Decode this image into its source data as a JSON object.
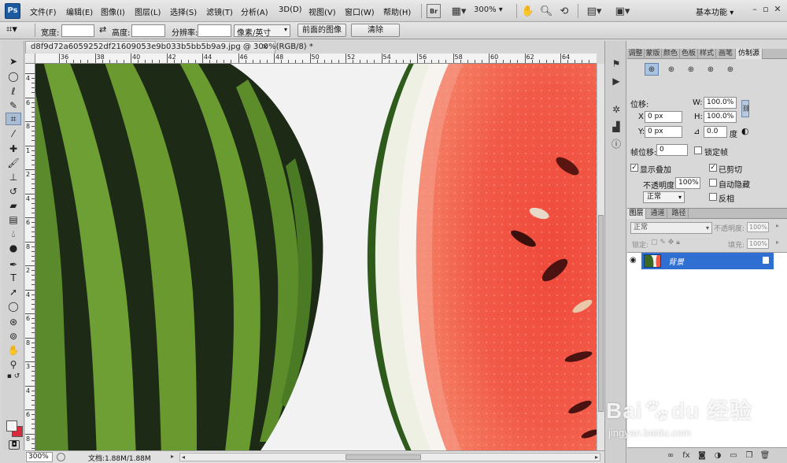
{
  "app": {
    "logo_text": "Ps",
    "menus": [
      "文件(F)",
      "编辑(E)",
      "图像(I)",
      "图层(L)",
      "选择(S)",
      "滤镜(T)",
      "分析(A)",
      "3D(D)",
      "视图(V)",
      "窗口(W)",
      "帮助(H)"
    ],
    "bridge_label": "Br",
    "zoom_level": "300%",
    "workspace": "基本功能",
    "workspace_arrow": "▾"
  },
  "options_bar": {
    "width_label": "宽度:",
    "width_value": "",
    "swap_icon": "⇄",
    "height_label": "高度:",
    "height_value": "",
    "resolution_label": "分辨率:",
    "resolution_value": "",
    "unit_select": "像素/英寸",
    "front_image_button": "前面的图像",
    "clear_button": "清除"
  },
  "document": {
    "tab_title": "d8f9d72a6059252df21609053e9b033b5bb5b9a9.jpg @ 300%(RGB/8) *",
    "close_symbol": "×",
    "ruler_h_labels": [
      "36",
      "38",
      "40",
      "42",
      "44",
      "46",
      "48",
      "50",
      "52",
      "54",
      "56",
      "58",
      "60",
      "62",
      "64"
    ],
    "ruler_v_labels": [
      "4",
      "6",
      "8",
      "1",
      "2",
      "4",
      "6",
      "8",
      "2",
      "4",
      "6",
      "8",
      "3",
      "4",
      "6",
      "8"
    ]
  },
  "status_bar": {
    "zoom": "300%",
    "doc_info": "文档:1.88M/1.88M"
  },
  "clone_source_panel": {
    "tabs": [
      "调整",
      "蒙版",
      "颜色",
      "色板",
      "样式",
      "画笔",
      "仿制源"
    ],
    "active_tab": "仿制源",
    "offset_label": "位移:",
    "x_label": "X:",
    "x_value": "0 px",
    "y_label": "Y:",
    "y_value": "0 px",
    "w_label": "W:",
    "w_value": "100.0%",
    "h_label": "H:",
    "h_value": "100.0%",
    "angle_value": "0.0",
    "angle_unit": "度",
    "frame_offset_label": "帧位移:",
    "frame_offset_value": "0",
    "lock_frame_label": "锁定帧",
    "show_overlay_label": "显示叠加",
    "clipped_label": "已剪切",
    "opacity_label": "不透明度:",
    "opacity_value": "100%",
    "auto_hide_label": "自动隐藏",
    "blend_mode": "正常",
    "invert_label": "反相"
  },
  "layers_panel": {
    "tabs": [
      "图层",
      "通道",
      "路径"
    ],
    "blend_mode": "正常",
    "opacity_label": "不透明度:",
    "opacity_value": "100%",
    "lock_label": "锁定:",
    "fill_label": "填充:",
    "fill_value": "100%",
    "layer_name": "背景"
  },
  "watermark": {
    "brand": "Bai",
    "brand_tail": "du 经验",
    "url": "jingyan.baidu.com"
  },
  "colors": {
    "accent_blue": "#2f6fd1",
    "foreground": "#f4f4f4",
    "background": "#d8283a"
  }
}
